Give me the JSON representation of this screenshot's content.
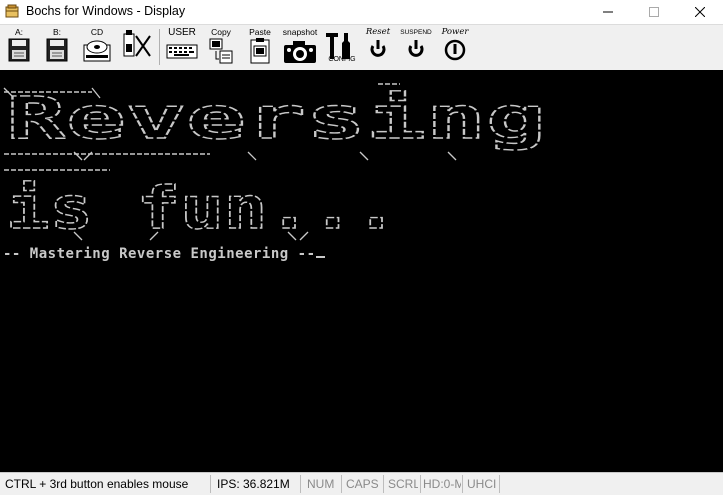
{
  "window": {
    "title": "Bochs for Windows - Display",
    "controls": [
      "minimize",
      "maximize",
      "close"
    ]
  },
  "toolbar": {
    "buttons": [
      {
        "id": "floppy-a",
        "label": "A:",
        "icon": "floppy-disk-icon"
      },
      {
        "id": "floppy-b",
        "label": "B:",
        "icon": "floppy-disk-icon"
      },
      {
        "id": "cdrom",
        "label": "CD",
        "icon": "cdrom-icon"
      },
      {
        "id": "usb",
        "label": "",
        "icon": "usb-stick-icon"
      },
      {
        "id": "user",
        "label": "USER",
        "icon": "keyboard-icon"
      },
      {
        "id": "copy",
        "label": "Copy",
        "icon": "copy-icon"
      },
      {
        "id": "paste",
        "label": "Paste",
        "icon": "paste-icon"
      },
      {
        "id": "snapshot",
        "label": "snapshot",
        "icon": "camera-icon"
      },
      {
        "id": "config",
        "label": "CONFIG",
        "icon": "config-icon"
      },
      {
        "id": "reset",
        "label": "Reset",
        "icon": "reset-icon"
      },
      {
        "id": "suspend",
        "label": "SUSPEND",
        "icon": "suspend-icon"
      },
      {
        "id": "power",
        "label": "Power",
        "icon": "power-icon"
      }
    ]
  },
  "display": {
    "banner_word_1": "Reversing",
    "banner_word_2": "is fun...",
    "tagline": "-- Mastering Reverse Engineering --",
    "text_color": "#c8c8c8",
    "background": "#000000"
  },
  "status": {
    "hint": "CTRL + 3rd button enables mouse",
    "ips": "IPS: 36.821M",
    "num": "NUM",
    "caps": "CAPS",
    "scrl": "SCRL",
    "hd": "HD:0-M",
    "uhci": "UHCI"
  }
}
